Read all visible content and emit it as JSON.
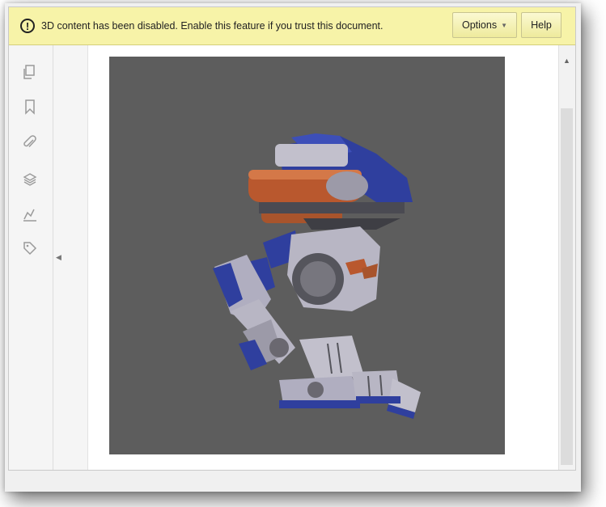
{
  "infobar": {
    "icon": "exclamation-circle-icon",
    "message": "3D content has been disabled. Enable this feature if you trust this document.",
    "options_label": "Options",
    "help_label": "Help",
    "background": "#f7f3a8"
  },
  "tools": [
    {
      "name": "page-thumbnails-icon"
    },
    {
      "name": "bookmark-icon"
    },
    {
      "name": "attachment-icon"
    },
    {
      "name": "layers-icon"
    },
    {
      "name": "signature-icon"
    },
    {
      "name": "tag-icon"
    }
  ],
  "viewport": {
    "background": "#5d5d5d",
    "content": "3D robot model render"
  },
  "colors": {
    "robot_blue": "#2f3f9e",
    "robot_orange": "#b9582e",
    "robot_silver": "#b8b6c4"
  }
}
